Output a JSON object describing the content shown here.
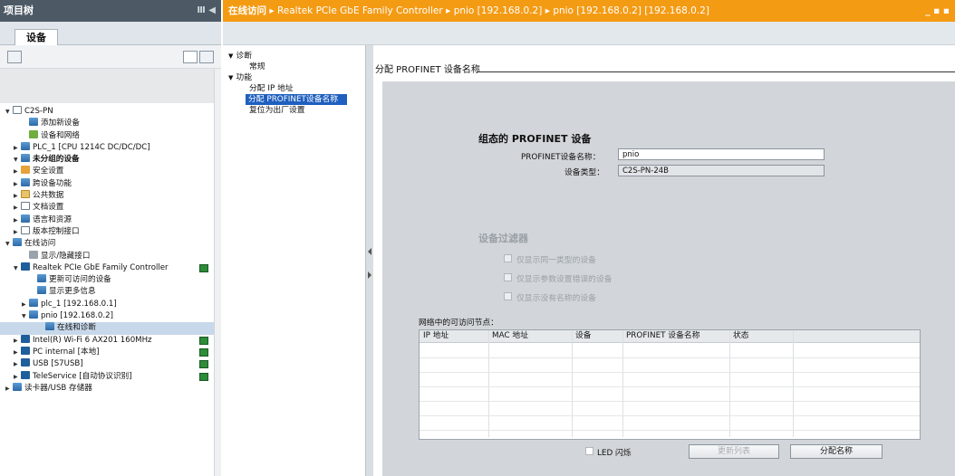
{
  "left_panel": {
    "title": "项目树",
    "title_controls": "Ⅲ ◀",
    "tab": "设备",
    "tree": [
      {
        "label": "C2S-PN",
        "indent": 0,
        "arrow": "▼",
        "icon": "doc"
      },
      {
        "label": "添加新设备",
        "indent": 2,
        "arrow": "",
        "icon": "blue"
      },
      {
        "label": "设备和网络",
        "indent": 2,
        "arrow": "",
        "icon": "green"
      },
      {
        "label": "PLC_1 [CPU 1214C DC/DC/DC]",
        "indent": 1,
        "arrow": "▶",
        "icon": "blue"
      },
      {
        "label": "未分组的设备",
        "indent": 1,
        "arrow": "▼",
        "icon": "blue",
        "bold": true
      },
      {
        "label": "安全设置",
        "indent": 1,
        "arrow": "▶",
        "icon": "orange"
      },
      {
        "label": "跨设备功能",
        "indent": 1,
        "arrow": "▶",
        "icon": "blue"
      },
      {
        "label": "公共数据",
        "indent": 1,
        "arrow": "▶",
        "icon": "folder"
      },
      {
        "label": "文档设置",
        "indent": 1,
        "arrow": "▶",
        "icon": "doc"
      },
      {
        "label": "语言和资源",
        "indent": 1,
        "arrow": "▶",
        "icon": "blue"
      },
      {
        "label": "版本控制接口",
        "indent": 1,
        "arrow": "▶",
        "icon": "doc"
      },
      {
        "label": "在线访问",
        "indent": 0,
        "arrow": "▼",
        "icon": "blue"
      },
      {
        "label": "显示/隐藏接口",
        "indent": 2,
        "arrow": "",
        "icon": "gray"
      },
      {
        "label": "Realtek PCIe GbE Family Controller",
        "indent": 1,
        "arrow": "▼",
        "icon": "pc",
        "status": "green"
      },
      {
        "label": "更新可访问的设备",
        "indent": 3,
        "arrow": "",
        "icon": "blue"
      },
      {
        "label": "显示更多信息",
        "indent": 3,
        "arrow": "",
        "icon": "blue"
      },
      {
        "label": "plc_1 [192.168.0.1]",
        "indent": 2,
        "arrow": "▶",
        "icon": "blue"
      },
      {
        "label": "pnio [192.168.0.2]",
        "indent": 2,
        "arrow": "▼",
        "icon": "blue"
      },
      {
        "label": "在线和诊断",
        "indent": 4,
        "arrow": "",
        "icon": "blue",
        "selected": true
      },
      {
        "label": "Intel(R) Wi-Fi 6 AX201 160MHz",
        "indent": 1,
        "arrow": "▶",
        "icon": "pc",
        "status": "green"
      },
      {
        "label": "PC internal [本地]",
        "indent": 1,
        "arrow": "▶",
        "icon": "pc",
        "status": "green"
      },
      {
        "label": "USB [S7USB]",
        "indent": 1,
        "arrow": "▶",
        "icon": "pc",
        "status": "green"
      },
      {
        "label": "TeleService [自动协议识别]",
        "indent": 1,
        "arrow": "▶",
        "icon": "pc",
        "status": "green"
      },
      {
        "label": "读卡器/USB 存储器",
        "indent": 0,
        "arrow": "▶",
        "icon": "blue"
      }
    ]
  },
  "breadcrumb": {
    "parts": [
      "在线访问",
      "Realtek PCIe GbE Family Controller",
      "pnio [192.168.0.2]",
      "pnio [192.168.0.2] [192.168.0.2]"
    ],
    "separator": "▸",
    "window_controls": "_ ▪ ▪"
  },
  "nav": {
    "items": [
      {
        "label": "诊断",
        "arrow": "▼",
        "child": false
      },
      {
        "label": "常规",
        "arrow": "",
        "child": true
      },
      {
        "label": "功能",
        "arrow": "▼",
        "child": false
      },
      {
        "label": "分配 IP 地址",
        "arrow": "",
        "child": true
      },
      {
        "label": "分配 PROFINET设备名称",
        "arrow": "",
        "child": true,
        "selected": true
      },
      {
        "label": "复位为出厂设置",
        "arrow": "",
        "child": true
      }
    ]
  },
  "content": {
    "title": "分配 PROFINET 设备名称",
    "section_configured": "组态的 PROFINET 设备",
    "device_name_label": "PROFINET设备名称：",
    "device_name_value": "pnio",
    "device_type_label": "设备类型：",
    "device_type_value": "C2S-PN-24B",
    "filter_heading": "设备过滤器",
    "filter_options": [
      "仅显示同一类型的设备",
      "仅显示参数设置错误的设备",
      "仅显示没有名称的设备"
    ],
    "nodes_label": "网络中的可访问节点：",
    "table_columns": [
      "IP 地址",
      "MAC 地址",
      "设备",
      "PROFINET 设备名称",
      "状态"
    ],
    "led_label": "LED 闪烁",
    "update_button": "更新列表",
    "assign_button": "分配名称"
  }
}
